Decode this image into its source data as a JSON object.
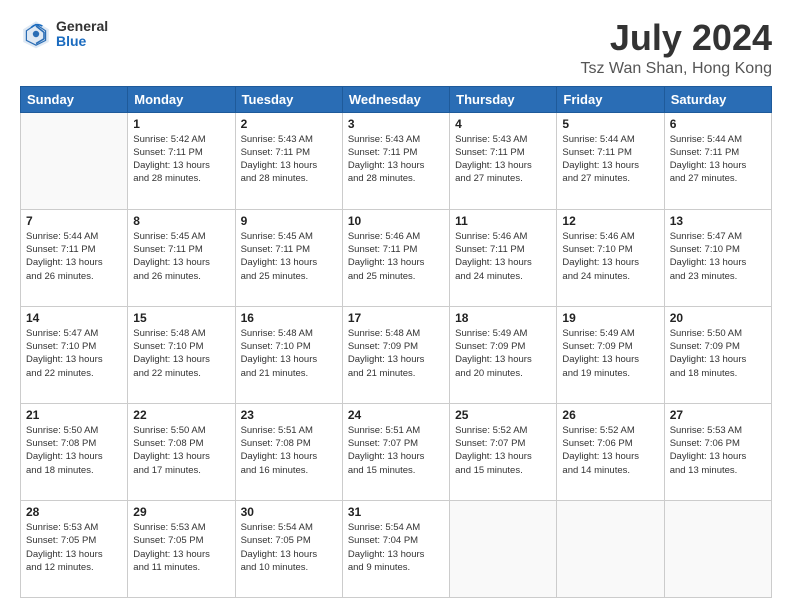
{
  "logo": {
    "general": "General",
    "blue": "Blue"
  },
  "header": {
    "title": "July 2024",
    "subtitle": "Tsz Wan Shan, Hong Kong"
  },
  "weekdays": [
    "Sunday",
    "Monday",
    "Tuesday",
    "Wednesday",
    "Thursday",
    "Friday",
    "Saturday"
  ],
  "weeks": [
    [
      {
        "day": "",
        "info": ""
      },
      {
        "day": "1",
        "info": "Sunrise: 5:42 AM\nSunset: 7:11 PM\nDaylight: 13 hours\nand 28 minutes."
      },
      {
        "day": "2",
        "info": "Sunrise: 5:43 AM\nSunset: 7:11 PM\nDaylight: 13 hours\nand 28 minutes."
      },
      {
        "day": "3",
        "info": "Sunrise: 5:43 AM\nSunset: 7:11 PM\nDaylight: 13 hours\nand 28 minutes."
      },
      {
        "day": "4",
        "info": "Sunrise: 5:43 AM\nSunset: 7:11 PM\nDaylight: 13 hours\nand 27 minutes."
      },
      {
        "day": "5",
        "info": "Sunrise: 5:44 AM\nSunset: 7:11 PM\nDaylight: 13 hours\nand 27 minutes."
      },
      {
        "day": "6",
        "info": "Sunrise: 5:44 AM\nSunset: 7:11 PM\nDaylight: 13 hours\nand 27 minutes."
      }
    ],
    [
      {
        "day": "7",
        "info": "Sunrise: 5:44 AM\nSunset: 7:11 PM\nDaylight: 13 hours\nand 26 minutes."
      },
      {
        "day": "8",
        "info": "Sunrise: 5:45 AM\nSunset: 7:11 PM\nDaylight: 13 hours\nand 26 minutes."
      },
      {
        "day": "9",
        "info": "Sunrise: 5:45 AM\nSunset: 7:11 PM\nDaylight: 13 hours\nand 25 minutes."
      },
      {
        "day": "10",
        "info": "Sunrise: 5:46 AM\nSunset: 7:11 PM\nDaylight: 13 hours\nand 25 minutes."
      },
      {
        "day": "11",
        "info": "Sunrise: 5:46 AM\nSunset: 7:11 PM\nDaylight: 13 hours\nand 24 minutes."
      },
      {
        "day": "12",
        "info": "Sunrise: 5:46 AM\nSunset: 7:10 PM\nDaylight: 13 hours\nand 24 minutes."
      },
      {
        "day": "13",
        "info": "Sunrise: 5:47 AM\nSunset: 7:10 PM\nDaylight: 13 hours\nand 23 minutes."
      }
    ],
    [
      {
        "day": "14",
        "info": "Sunrise: 5:47 AM\nSunset: 7:10 PM\nDaylight: 13 hours\nand 22 minutes."
      },
      {
        "day": "15",
        "info": "Sunrise: 5:48 AM\nSunset: 7:10 PM\nDaylight: 13 hours\nand 22 minutes."
      },
      {
        "day": "16",
        "info": "Sunrise: 5:48 AM\nSunset: 7:10 PM\nDaylight: 13 hours\nand 21 minutes."
      },
      {
        "day": "17",
        "info": "Sunrise: 5:48 AM\nSunset: 7:09 PM\nDaylight: 13 hours\nand 21 minutes."
      },
      {
        "day": "18",
        "info": "Sunrise: 5:49 AM\nSunset: 7:09 PM\nDaylight: 13 hours\nand 20 minutes."
      },
      {
        "day": "19",
        "info": "Sunrise: 5:49 AM\nSunset: 7:09 PM\nDaylight: 13 hours\nand 19 minutes."
      },
      {
        "day": "20",
        "info": "Sunrise: 5:50 AM\nSunset: 7:09 PM\nDaylight: 13 hours\nand 18 minutes."
      }
    ],
    [
      {
        "day": "21",
        "info": "Sunrise: 5:50 AM\nSunset: 7:08 PM\nDaylight: 13 hours\nand 18 minutes."
      },
      {
        "day": "22",
        "info": "Sunrise: 5:50 AM\nSunset: 7:08 PM\nDaylight: 13 hours\nand 17 minutes."
      },
      {
        "day": "23",
        "info": "Sunrise: 5:51 AM\nSunset: 7:08 PM\nDaylight: 13 hours\nand 16 minutes."
      },
      {
        "day": "24",
        "info": "Sunrise: 5:51 AM\nSunset: 7:07 PM\nDaylight: 13 hours\nand 15 minutes."
      },
      {
        "day": "25",
        "info": "Sunrise: 5:52 AM\nSunset: 7:07 PM\nDaylight: 13 hours\nand 15 minutes."
      },
      {
        "day": "26",
        "info": "Sunrise: 5:52 AM\nSunset: 7:06 PM\nDaylight: 13 hours\nand 14 minutes."
      },
      {
        "day": "27",
        "info": "Sunrise: 5:53 AM\nSunset: 7:06 PM\nDaylight: 13 hours\nand 13 minutes."
      }
    ],
    [
      {
        "day": "28",
        "info": "Sunrise: 5:53 AM\nSunset: 7:05 PM\nDaylight: 13 hours\nand 12 minutes."
      },
      {
        "day": "29",
        "info": "Sunrise: 5:53 AM\nSunset: 7:05 PM\nDaylight: 13 hours\nand 11 minutes."
      },
      {
        "day": "30",
        "info": "Sunrise: 5:54 AM\nSunset: 7:05 PM\nDaylight: 13 hours\nand 10 minutes."
      },
      {
        "day": "31",
        "info": "Sunrise: 5:54 AM\nSunset: 7:04 PM\nDaylight: 13 hours\nand 9 minutes."
      },
      {
        "day": "",
        "info": ""
      },
      {
        "day": "",
        "info": ""
      },
      {
        "day": "",
        "info": ""
      }
    ]
  ]
}
